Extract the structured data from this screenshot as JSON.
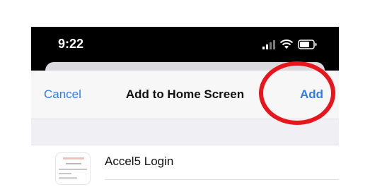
{
  "status_bar": {
    "time": "9:22",
    "icons": [
      "signal-icon",
      "wifi-icon",
      "battery-icon"
    ]
  },
  "sheet": {
    "cancel_label": "Cancel",
    "title": "Add to Home Screen",
    "add_label": "Add"
  },
  "shortcut": {
    "name": "Accel5 Login"
  },
  "colors": {
    "accent": "#2f7bf6",
    "annotation": "#e8161c",
    "status_bar_bg": "#000000"
  }
}
